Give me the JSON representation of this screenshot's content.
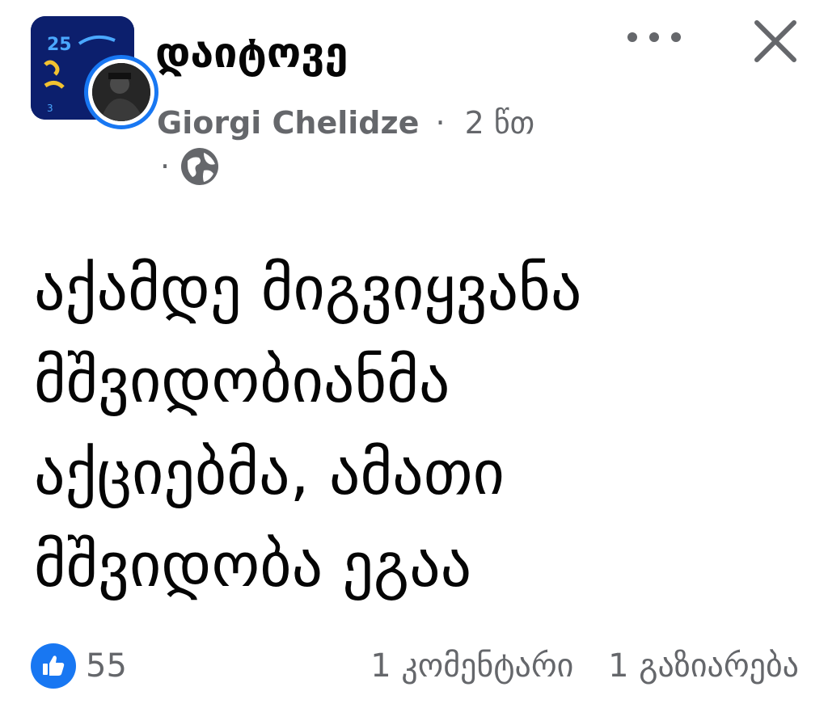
{
  "post": {
    "group_name": "დაიტოვე",
    "author": "Giorgi Chelidze",
    "separator": "·",
    "time": "2 წთ",
    "privacy_icon": "globe-icon",
    "text": "აქამდე მიგვიყვანა\nმშვიდობიანმა\nაქციებმა, ამათი\nმშვიდობა ეგაა"
  },
  "reactions": {
    "icon": "like-icon",
    "count": "55"
  },
  "engagement": {
    "comments": "1 კომენტარი",
    "shares": "1 გაზიარება"
  },
  "header": {
    "more_icon": "more-options-icon",
    "close_icon": "close-icon"
  },
  "group_avatar": {
    "badge_text": "25"
  },
  "colors": {
    "accent": "#1877f2",
    "secondary_text": "#65676b",
    "primary_text": "#050505",
    "group_avatar_bg": "#0a1a5e"
  }
}
